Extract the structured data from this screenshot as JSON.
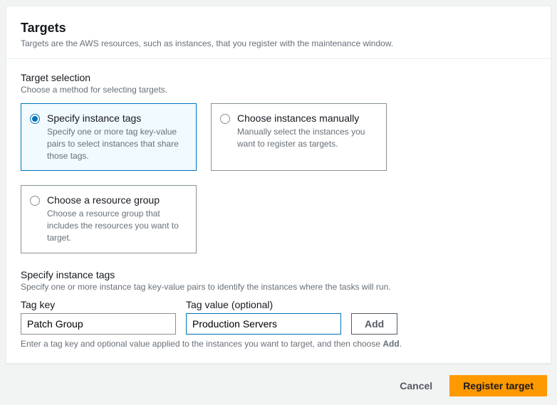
{
  "panel": {
    "title": "Targets",
    "description": "Targets are the AWS resources, such as instances, that you register with the maintenance window."
  },
  "target_selection": {
    "heading": "Target selection",
    "description": "Choose a method for selecting targets.",
    "options": [
      {
        "title": "Specify instance tags",
        "description": "Specify one or more tag key-value pairs to select instances that share those tags.",
        "selected": true
      },
      {
        "title": "Choose instances manually",
        "description": "Manually select the instances you want to register as targets.",
        "selected": false
      },
      {
        "title": "Choose a resource group",
        "description": "Choose a resource group that includes the resources you want to target.",
        "selected": false
      }
    ]
  },
  "tag_section": {
    "heading": "Specify instance tags",
    "description": "Specify one or more instance tag key-value pairs to identify the instances where the tasks will run.",
    "tag_key_label": "Tag key",
    "tag_value_label": "Tag value (optional)",
    "tag_key_value": "Patch Group",
    "tag_value_value": "Production Servers",
    "add_label": "Add",
    "hint_prefix": "Enter a tag key and optional value applied to the instances you want to target, and then choose ",
    "hint_bold": "Add",
    "hint_suffix": "."
  },
  "footer": {
    "cancel": "Cancel",
    "register": "Register target"
  }
}
